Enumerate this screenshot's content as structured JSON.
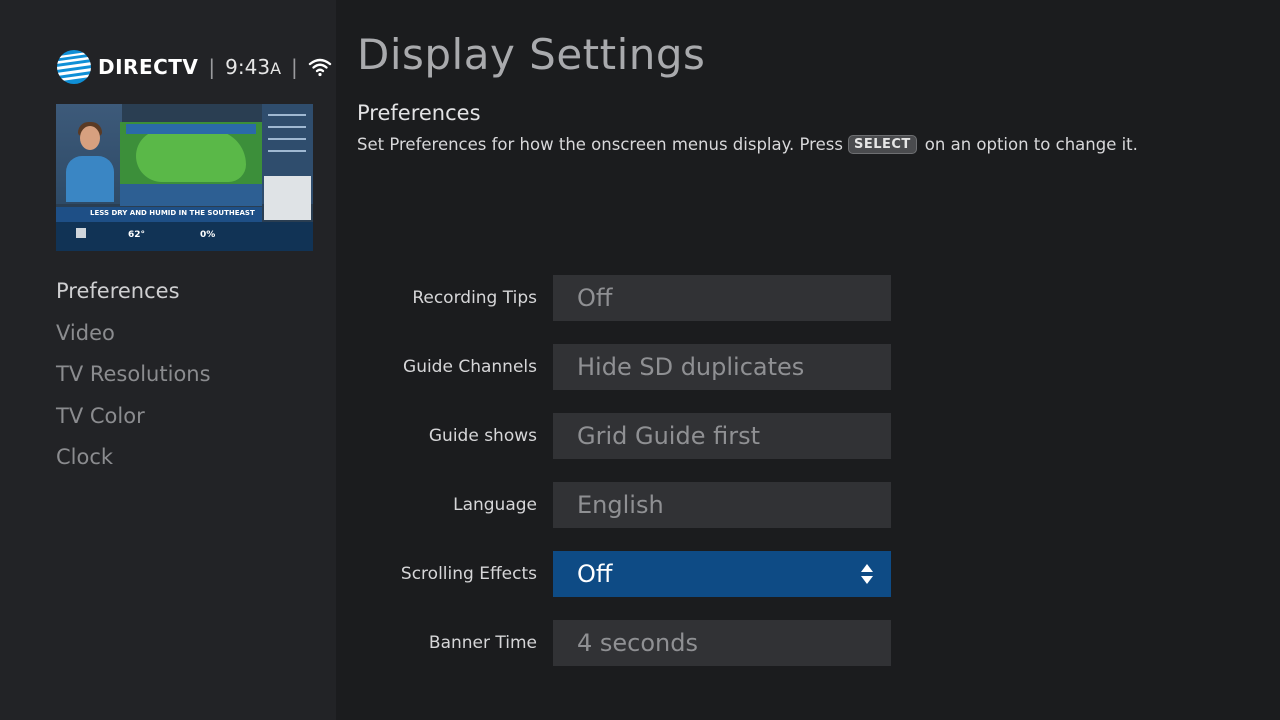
{
  "header": {
    "brand": "DIRECTV",
    "time": "9:43",
    "time_suffix": "A",
    "icons": [
      "att-globe-logo",
      "wifi-icon"
    ]
  },
  "preview": {
    "banner": "LESS DRY AND HUMID IN THE SOUTHEAST",
    "temperature": "62°",
    "precip": "0%"
  },
  "sidebar": {
    "items": [
      {
        "label": "Preferences",
        "active": true
      },
      {
        "label": "Video",
        "active": false
      },
      {
        "label": "TV Resolutions",
        "active": false
      },
      {
        "label": "TV Color",
        "active": false
      },
      {
        "label": "Clock",
        "active": false
      }
    ]
  },
  "main": {
    "title": "Display Settings",
    "section_title": "Preferences",
    "desc_before": "Set Preferences for how the onscreen menus display. Press",
    "desc_key": "SELECT",
    "desc_after": "on an option to change it.",
    "settings": [
      {
        "label": "Recording Tips",
        "value": "Off",
        "selected": false
      },
      {
        "label": "Guide Channels",
        "value": "Hide SD duplicates",
        "selected": false
      },
      {
        "label": "Guide shows",
        "value": "Grid Guide first",
        "selected": false
      },
      {
        "label": "Language",
        "value": "English",
        "selected": false
      },
      {
        "label": "Scrolling Effects",
        "value": "Off",
        "selected": true
      },
      {
        "label": "Banner Time",
        "value": "4 seconds",
        "selected": false
      }
    ]
  },
  "colors": {
    "background": "#1b1c1e",
    "sidebar": "#222326",
    "selected_row": "#0e4b85",
    "row": "#313235"
  }
}
